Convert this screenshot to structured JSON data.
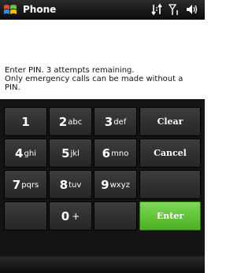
{
  "titlebar": {
    "app_title": "Phone",
    "icons": [
      "windows-start-icon",
      "connectivity-icon",
      "signal-icon",
      "speaker-icon"
    ]
  },
  "message": {
    "lines": [
      "Enter PIN. 3 attempts remaining.",
      "Only emergency calls can be made without a",
      "PIN."
    ]
  },
  "keypad": {
    "keys": [
      {
        "digit": "1",
        "letters": ""
      },
      {
        "digit": "2",
        "letters": "abc"
      },
      {
        "digit": "3",
        "letters": "def"
      },
      {
        "digit": "4",
        "letters": "ghi"
      },
      {
        "digit": "5",
        "letters": "jkl"
      },
      {
        "digit": "6",
        "letters": "mno"
      },
      {
        "digit": "7",
        "letters": "pqrs"
      },
      {
        "digit": "8",
        "letters": "tuv"
      },
      {
        "digit": "9",
        "letters": "wxyz"
      },
      {
        "digit": "0",
        "letters": "+"
      }
    ],
    "clear_label": "Clear",
    "cancel_label": "Cancel",
    "enter_label": "Enter"
  },
  "colors": {
    "enter_green": "#5cc430",
    "key_gray": "#333333",
    "titlebar": "#1a1a1a"
  }
}
